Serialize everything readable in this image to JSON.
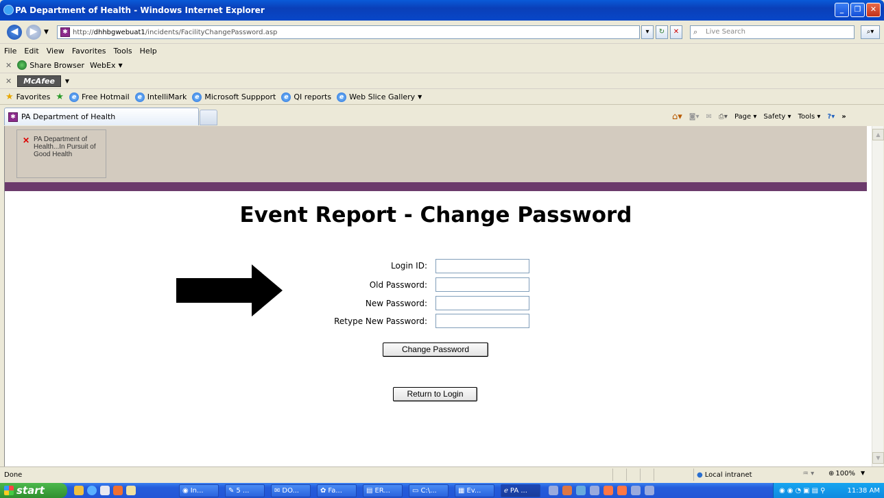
{
  "window": {
    "title": "PA Department of Health - Windows Internet Explorer"
  },
  "address": {
    "prefix": "http://",
    "host": "dhhbgwebuat1",
    "path": "/incidents/FacilityChangePassword.asp"
  },
  "search": {
    "placeholder": "Live Search"
  },
  "menu": [
    "File",
    "Edit",
    "View",
    "Favorites",
    "Tools",
    "Help"
  ],
  "toolbar1": {
    "share": "Share Browser",
    "webex": "WebEx"
  },
  "toolbar2": {
    "mcafee": "McAfee"
  },
  "favorites": {
    "label": "Favorites",
    "items": [
      "Free Hotmail",
      "IntelliMark",
      "Microsoft Suppport",
      "QI reports",
      "Web Slice Gallery"
    ]
  },
  "tab": {
    "label": "PA Department of Health"
  },
  "commandbar": {
    "page": "Page",
    "safety": "Safety",
    "tools": "Tools"
  },
  "page": {
    "logo_alt": "PA Department of Health...In Pursuit of Good Health",
    "title": "Event Report - Change Password",
    "fields": [
      {
        "label": "Login ID:",
        "value": ""
      },
      {
        "label": "Old Password:",
        "value": ""
      },
      {
        "label": "New Password:",
        "value": ""
      },
      {
        "label": "Retype New Password:",
        "value": ""
      }
    ],
    "change_button": "Change Password",
    "return_button": "Return to Login"
  },
  "status": {
    "text": "Done",
    "zone": "Local intranet",
    "zoom": "100%"
  },
  "taskbar": {
    "start": "start",
    "tasks": [
      "In...",
      "5 ...",
      "DO...",
      "Fa...",
      "ER...",
      "C:\\...",
      "Ev...",
      "PA ..."
    ],
    "clock": "11:38 AM"
  },
  "colors": {
    "banner": "#d3cbbf",
    "stripe": "#6b3a6b",
    "titlebar": "#0a4fc8"
  }
}
